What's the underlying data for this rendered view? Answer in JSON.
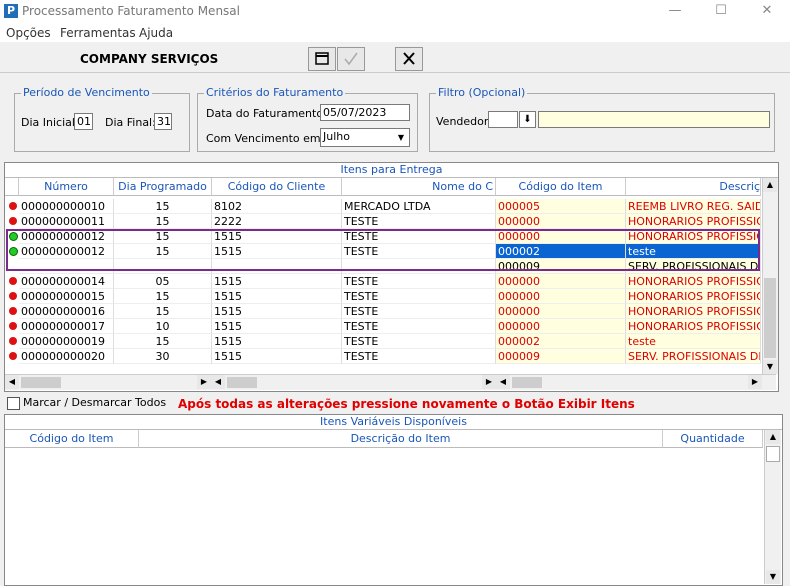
{
  "window": {
    "title": "Processamento Faturamento Mensal",
    "minimize": "—",
    "maximize": "☐",
    "close": "✕"
  },
  "menu": [
    "Opções",
    "Ferramentas",
    "Ajuda"
  ],
  "company": "COMPANY SERVIÇOS",
  "periodo": {
    "title": "Período de Vencimento",
    "dia_inicial_label": "Dia Inicial:",
    "dia_inicial": "01",
    "dia_final_label": "Dia Final:",
    "dia_final": "31"
  },
  "criterios": {
    "title": "Critérios do Faturamento",
    "data_label": "Data do Faturamento:",
    "data": "05/07/2023",
    "venc_label": "Com Vencimento em:",
    "venc": "Julho"
  },
  "filtro": {
    "title": "Filtro (Opcional)",
    "vendedor_label": "Vendedor:",
    "vendedor": ""
  },
  "itens_entrega": {
    "caption": "Itens para Entrega",
    "headers": [
      "Número",
      "Dia Programado",
      "Código do Cliente",
      "Nome do C",
      "Código do Item",
      "Descriç"
    ],
    "rows": [
      {
        "status": "red",
        "numero": "000000000010",
        "dia": "15",
        "cliente": "8102",
        "nome": "MERCADO LTDA",
        "codigo": "000005",
        "descricao": "REEMB LIVRO REG. SAIDAS",
        "red": true
      },
      {
        "status": "red",
        "numero": "000000000011",
        "dia": "15",
        "cliente": "2222",
        "nome": "TESTE",
        "codigo": "000000",
        "descricao": "HONORARIOS PROFISSION",
        "red": true
      },
      {
        "status": "green",
        "numero": "000000000012",
        "dia": "15",
        "cliente": "1515",
        "nome": "TESTE",
        "codigo": "000000",
        "descricao": "HONORARIOS PROFISSION",
        "red": true
      },
      {
        "status": "green",
        "numero": "000000000012",
        "dia": "15",
        "cliente": "1515",
        "nome": "TESTE",
        "codigo": "000002",
        "descricao": "teste",
        "red": false,
        "selected": true
      },
      {
        "status": "",
        "numero": "",
        "dia": "",
        "cliente": "",
        "nome": "",
        "codigo": "000009",
        "descricao": "SERV. PROFISSIONAIS DIV",
        "red": false
      },
      {
        "status": "red",
        "numero": "000000000014",
        "dia": "05",
        "cliente": "1515",
        "nome": "TESTE",
        "codigo": "000000",
        "descricao": "HONORARIOS PROFISSION",
        "red": true
      },
      {
        "status": "red",
        "numero": "000000000015",
        "dia": "15",
        "cliente": "1515",
        "nome": "TESTE",
        "codigo": "000000",
        "descricao": "HONORARIOS PROFISSION",
        "red": true
      },
      {
        "status": "red",
        "numero": "000000000016",
        "dia": "15",
        "cliente": "1515",
        "nome": "TESTE",
        "codigo": "000000",
        "descricao": "HONORARIOS PROFISSION",
        "red": true
      },
      {
        "status": "red",
        "numero": "000000000017",
        "dia": "10",
        "cliente": "1515",
        "nome": "TESTE",
        "codigo": "000000",
        "descricao": "HONORARIOS PROFISSION",
        "red": true
      },
      {
        "status": "red",
        "numero": "000000000019",
        "dia": "15",
        "cliente": "1515",
        "nome": "TESTE",
        "codigo": "000002",
        "descricao": "teste",
        "red": true
      },
      {
        "status": "red",
        "numero": "000000000020",
        "dia": "30",
        "cliente": "1515",
        "nome": "TESTE",
        "codigo": "000009",
        "descricao": "SERV. PROFISSIONAIS DIV",
        "red": true
      }
    ]
  },
  "marcar_label": "Marcar / Desmarcar Todos",
  "warning": "Após todas as alterações pressione novamente o Botão Exibir Itens",
  "itens_variaveis": {
    "caption": "Itens Variáveis Disponíveis",
    "headers": [
      "Código do Item",
      "Descrição do Item",
      "Quantidade"
    ]
  },
  "colors": {
    "accent": "#1a56b8",
    "warning": "#e00000",
    "highlight": "#7a2a8a",
    "selection": "#0a64d2"
  }
}
